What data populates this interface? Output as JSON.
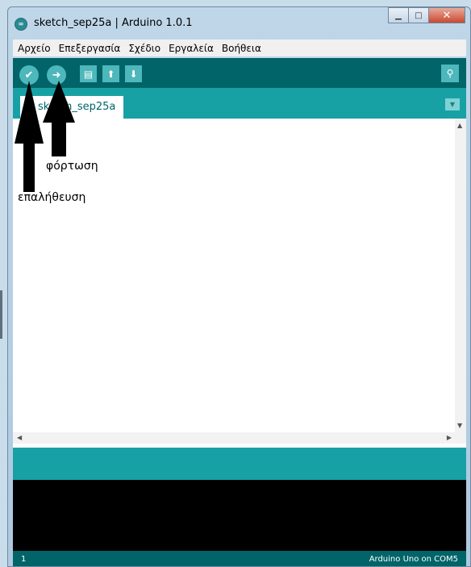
{
  "window": {
    "title": "sketch_sep25a | Arduino 1.0.1"
  },
  "menu": [
    "Αρχείο",
    "Επεξεργασία",
    "Σχέδιο",
    "Εργαλεία",
    "Βοήθεια"
  ],
  "tab": {
    "label": "sketch_sep25a"
  },
  "editor": {
    "text": ""
  },
  "status": {
    "line": "1",
    "board": "Arduino Uno on COM5"
  },
  "annotations": {
    "upload": "φόρτωση",
    "verify": "επαλήθευση"
  },
  "colors": {
    "toolbar": "#006468",
    "tab_strip": "#17a1a5",
    "button": "#4db7bb",
    "console": "#000000"
  }
}
